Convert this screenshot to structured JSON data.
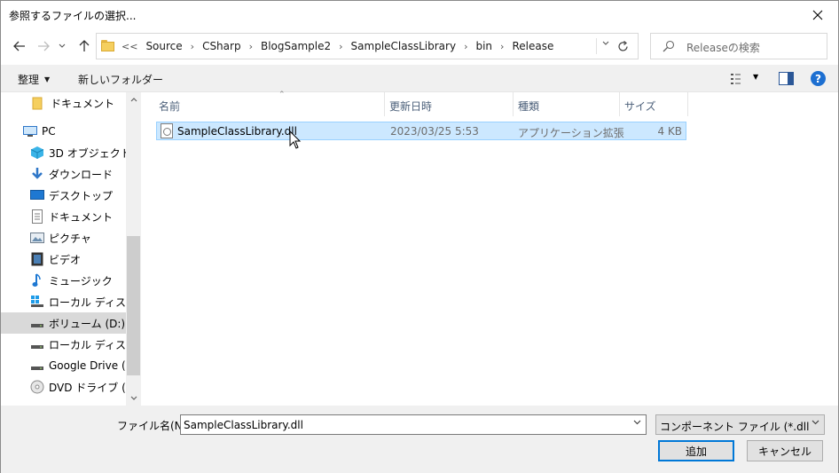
{
  "window": {
    "title": "参照するファイルの選択..."
  },
  "address": {
    "lead": "<<",
    "crumbs": [
      "Source",
      "CSharp",
      "BlogSample2",
      "SampleClassLibrary",
      "bin",
      "Release"
    ],
    "separator": "›"
  },
  "search": {
    "placeholder": "Releaseの検索"
  },
  "toolbar": {
    "organize_label": "整理",
    "new_folder_label": "新しいフォルダー",
    "help_label": "?"
  },
  "sidebar": {
    "items": [
      {
        "label": "ドキュメント",
        "icon": "folder-icon"
      },
      {
        "label": "PC",
        "icon": "pc-icon"
      },
      {
        "label": "3D オブジェクト",
        "icon": "3d-objects-icon"
      },
      {
        "label": "ダウンロード",
        "icon": "download-icon"
      },
      {
        "label": "デスクトップ",
        "icon": "desktop-icon"
      },
      {
        "label": "ドキュメント",
        "icon": "document-icon"
      },
      {
        "label": "ピクチャ",
        "icon": "pictures-icon"
      },
      {
        "label": "ビデオ",
        "icon": "video-icon"
      },
      {
        "label": "ミュージック",
        "icon": "music-icon"
      },
      {
        "label": "ローカル ディスク (C:)",
        "icon": "local-disk-icon"
      },
      {
        "label": "ボリューム (D:)",
        "icon": "drive-icon",
        "selected": true
      },
      {
        "label": "ローカル ディスク (E:)",
        "icon": "drive-icon"
      },
      {
        "label": "Google Drive (F:)",
        "icon": "drive-icon"
      },
      {
        "label": "DVD ドライブ (I:) D",
        "icon": "dvd-icon"
      }
    ]
  },
  "files": {
    "columns": [
      "名前",
      "更新日時",
      "種類",
      "サイズ"
    ],
    "rows": [
      {
        "name": "SampleClassLibrary.dll",
        "modified": "2023/03/25 5:53",
        "type": "アプリケーション拡張",
        "size": "4 KB",
        "icon": "dll-file-icon"
      }
    ]
  },
  "bottom": {
    "filename_label": "ファイル名(N):",
    "filename_value": "SampleClassLibrary.dll",
    "filter_value": "コンポーネント ファイル (*.dll;*.tlb;*.o",
    "ok_label": "追加",
    "cancel_label": "キャンセル"
  },
  "colors": {
    "selection": "#cce8ff",
    "selection_border": "#99d1ff",
    "accent": "#0078d7",
    "folder": "#f5cf5f"
  }
}
